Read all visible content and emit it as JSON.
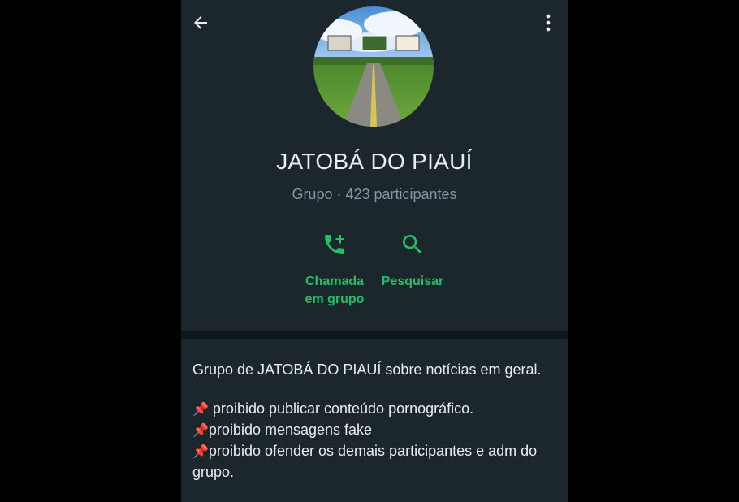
{
  "header": {
    "back_icon": "arrow-left-icon",
    "menu_icon": "more-vertical-icon"
  },
  "group": {
    "name": "JATOBÁ DO PIAUÍ",
    "meta": "Grupo · 423 participantes"
  },
  "actions": [
    {
      "label_line1": "Chamada",
      "label_line2": "em grupo",
      "icon": "add-call-icon"
    },
    {
      "label": "Pesquisar",
      "icon": "search-icon"
    }
  ],
  "description": {
    "intro": "Grupo de JATOBÁ DO PIAUÍ sobre notícias em geral.",
    "rules": [
      {
        "icon": "📌",
        "text": " proibido publicar conteúdo pornográfico."
      },
      {
        "icon": "📌",
        "text": "proibido mensagens fake"
      },
      {
        "icon": "📌",
        "text": "proibido ofender os demais participantes e adm do grupo."
      }
    ]
  },
  "colors": {
    "accent": "#21c063",
    "background": "#1b262d",
    "primary_text": "#e9edef",
    "secondary_text": "#8696a0"
  }
}
